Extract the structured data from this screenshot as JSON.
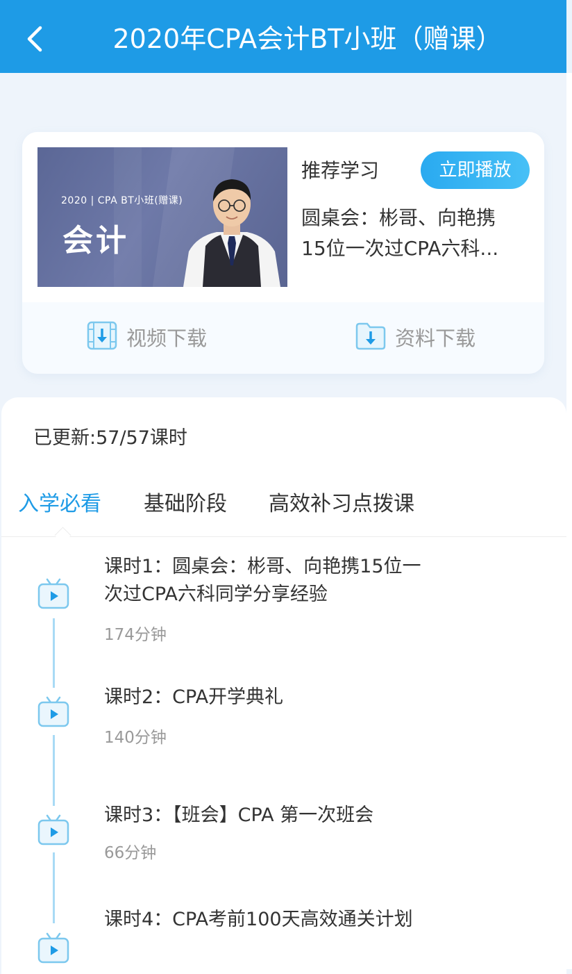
{
  "header": {
    "title": "2020年CPA会计BT小班（赠课）",
    "back_icon": "chevron-left-icon",
    "color": "#1e9be6"
  },
  "course_card": {
    "thumbnail": {
      "subtitle": "2020 | CPA BT小班(赠课)",
      "title": "会计"
    },
    "recommend_label": "推荐学习",
    "play_button": "立即播放",
    "recommend_lines": [
      "圆桌会：彬哥、向艳携",
      "15位一次过CPA六科..."
    ],
    "video_download": {
      "label": "视频下载",
      "icon": "video-download-icon"
    },
    "doc_download": {
      "label": "资料下载",
      "icon": "folder-download-icon"
    }
  },
  "lessons_panel": {
    "update_status": "已更新:57/57课时",
    "tabs": [
      {
        "label": "入学必看",
        "active": true
      },
      {
        "label": "基础阶段",
        "active": false
      },
      {
        "label": "高效补习点拨课",
        "active": false
      }
    ],
    "accent_color": "#1e9be6",
    "lessons": [
      {
        "title_lines": [
          "课时1：圆桌会：彬哥、向艳携15位一",
          "次过CPA六科同学分享经验"
        ],
        "duration": "174分钟"
      },
      {
        "title_lines": [
          "课时2：CPA开学典礼"
        ],
        "duration": "140分钟"
      },
      {
        "title_lines": [
          "课时3：【班会】CPA 第一次班会"
        ],
        "duration": "66分钟"
      },
      {
        "title_lines": [
          "课时4：CPA考前100天高效通关计划"
        ],
        "duration": ""
      }
    ]
  }
}
